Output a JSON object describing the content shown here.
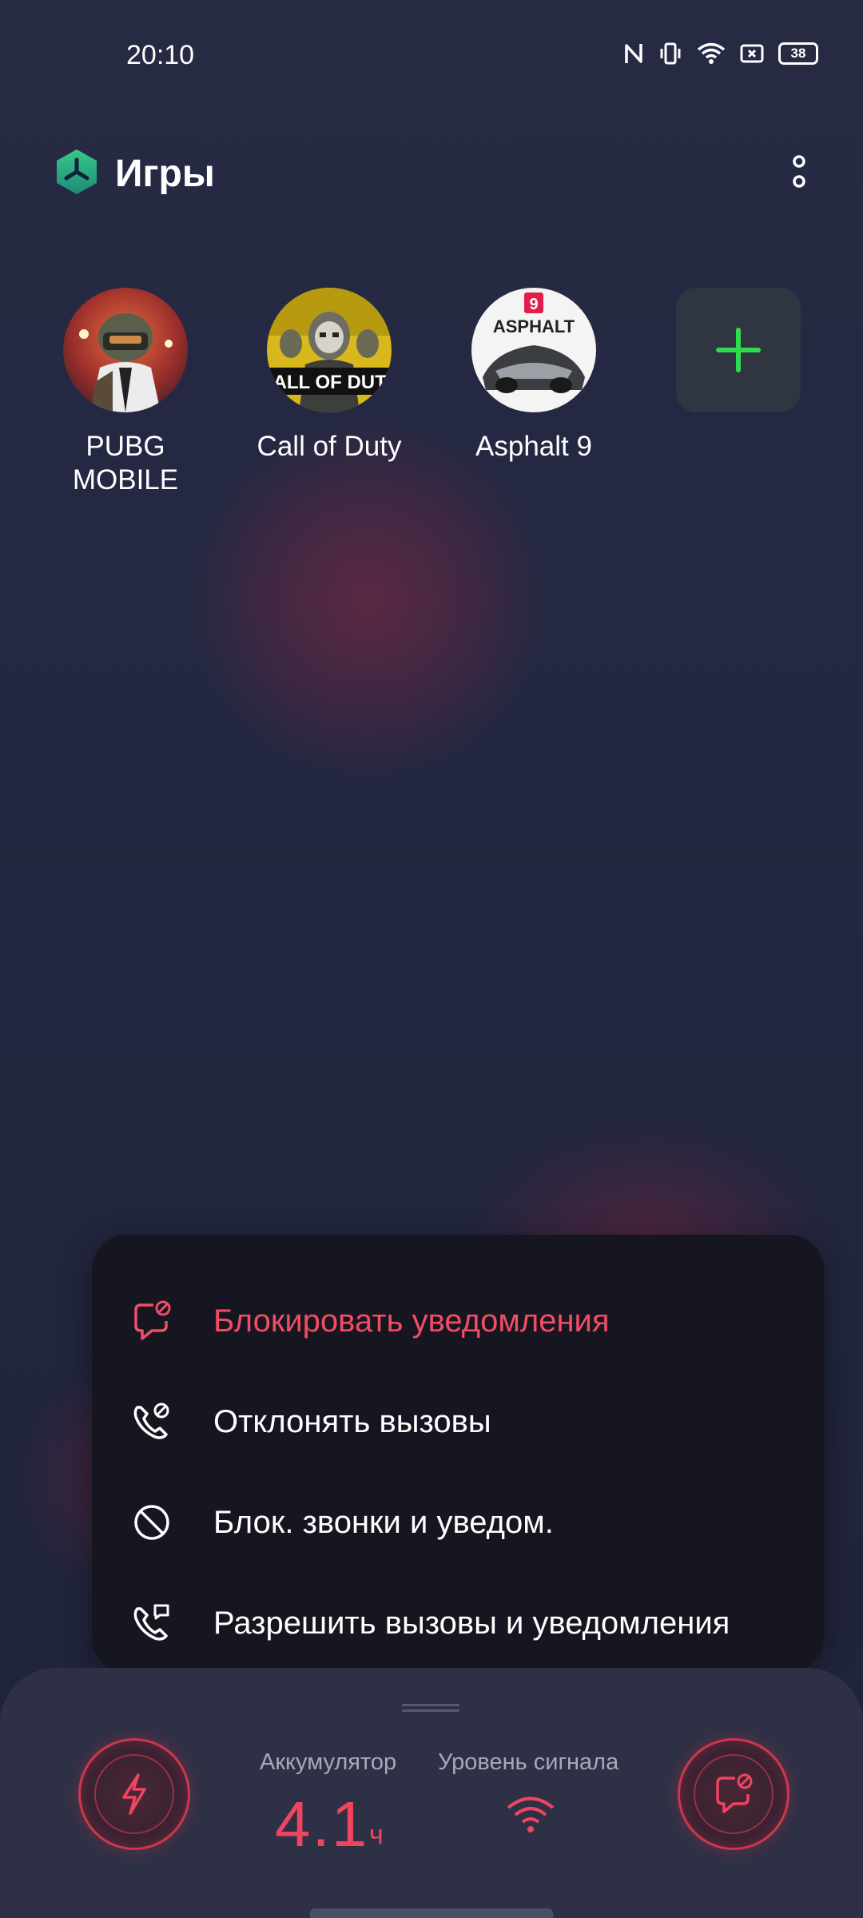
{
  "status_bar": {
    "time": "20:10",
    "battery_level": "38",
    "icons": [
      "nfc-icon",
      "vibrate-icon",
      "wifi-icon",
      "screen-record-icon",
      "battery-icon"
    ]
  },
  "header": {
    "title": "Игры",
    "logo_icon": "game-space-logo-icon",
    "more_icon": "more-vertical-icon"
  },
  "games": [
    {
      "label": "PUBG\nMOBILE",
      "icon": "pubg-mobile-icon"
    },
    {
      "label": "Call of Duty",
      "icon": "call-of-duty-icon",
      "icon_text": "CALL OF DUTY"
    },
    {
      "label": "Asphalt 9",
      "icon": "asphalt-9-icon",
      "icon_text": "ASPHALT",
      "badge": "9"
    }
  ],
  "add_game": {
    "icon": "plus-icon",
    "color": "#2edb4c"
  },
  "menu": {
    "items": [
      {
        "label": "Блокировать уведомления",
        "icon": "block-notifications-icon",
        "active": true
      },
      {
        "label": "Отклонять вызовы",
        "icon": "reject-calls-icon",
        "active": false
      },
      {
        "label": "Блок. звонки и уведом.",
        "icon": "block-all-icon",
        "active": false
      },
      {
        "label": "Разрешить вызовы и уведомления",
        "icon": "allow-calls-notifications-icon",
        "active": false
      }
    ],
    "active_color": "#f14d65"
  },
  "panel": {
    "battery_label": "Аккумулятор",
    "battery_value": "4.1",
    "battery_unit": "ч",
    "signal_label": "Уровень сигнала",
    "left_button_icon": "lightning-icon",
    "right_button_icon": "block-notifications-icon",
    "accent_color": "#f0445f"
  }
}
